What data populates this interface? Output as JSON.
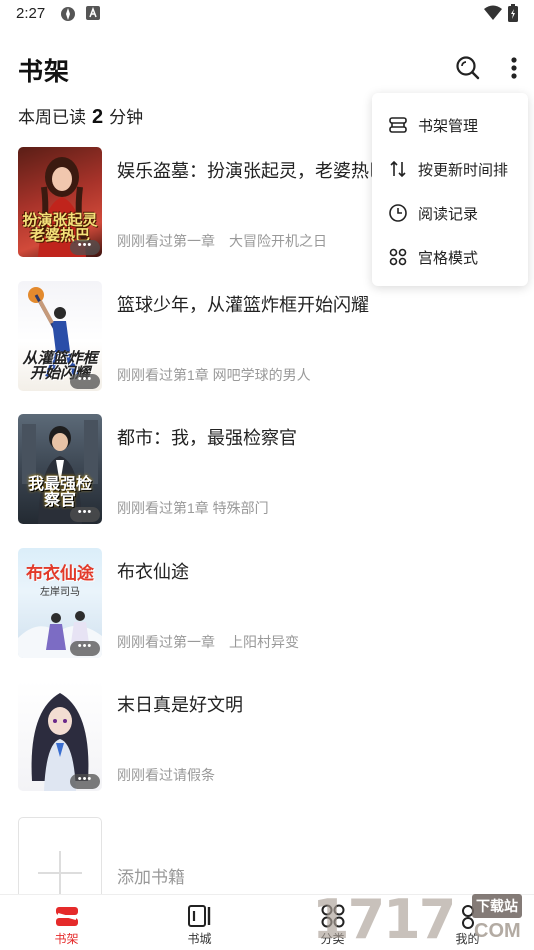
{
  "status_bar": {
    "time": "2:27"
  },
  "header": {
    "title": "书架"
  },
  "weekly": {
    "prefix": "本周已读",
    "minutes": "2",
    "suffix": "分钟"
  },
  "books": [
    {
      "title": "娱乐盗墓：扮演张起灵，老婆热巴",
      "progress": "刚刚看过第一章　大冒险开机之日",
      "cover_text": "扮演张起灵老婆热巴"
    },
    {
      "title": "篮球少年，从灌篮炸框开始闪耀",
      "progress": "刚刚看过第1章 网吧学球的男人",
      "cover_text": "从灌篮炸框开始闪耀"
    },
    {
      "title": "都市：我，最强检察官",
      "progress": "刚刚看过第1章 特殊部门",
      "cover_text": "我最强检察官"
    },
    {
      "title": "布衣仙途",
      "progress": "刚刚看过第一章　上阳村异变",
      "cover_text": "布衣仙途",
      "cover_author": "左岸司马"
    },
    {
      "title": "末日真是好文明",
      "progress": "刚刚看过请假条"
    }
  ],
  "add_book": {
    "label": "添加书籍"
  },
  "menu": {
    "items": [
      {
        "label": "书架管理",
        "icon": "shelf-manage-icon"
      },
      {
        "label": "按更新时间排",
        "icon": "sort-icon"
      },
      {
        "label": "阅读记录",
        "icon": "clock-icon"
      },
      {
        "label": "宫格模式",
        "icon": "grid-icon"
      }
    ]
  },
  "tabs": [
    {
      "label": "书架",
      "active": true
    },
    {
      "label": "书城"
    },
    {
      "label": "分类"
    },
    {
      "label": "我的"
    }
  ],
  "watermark": {
    "digits": "1717",
    "top": "下载站",
    "bottom": "COM"
  },
  "colors": {
    "accent": "#e52a2a"
  }
}
